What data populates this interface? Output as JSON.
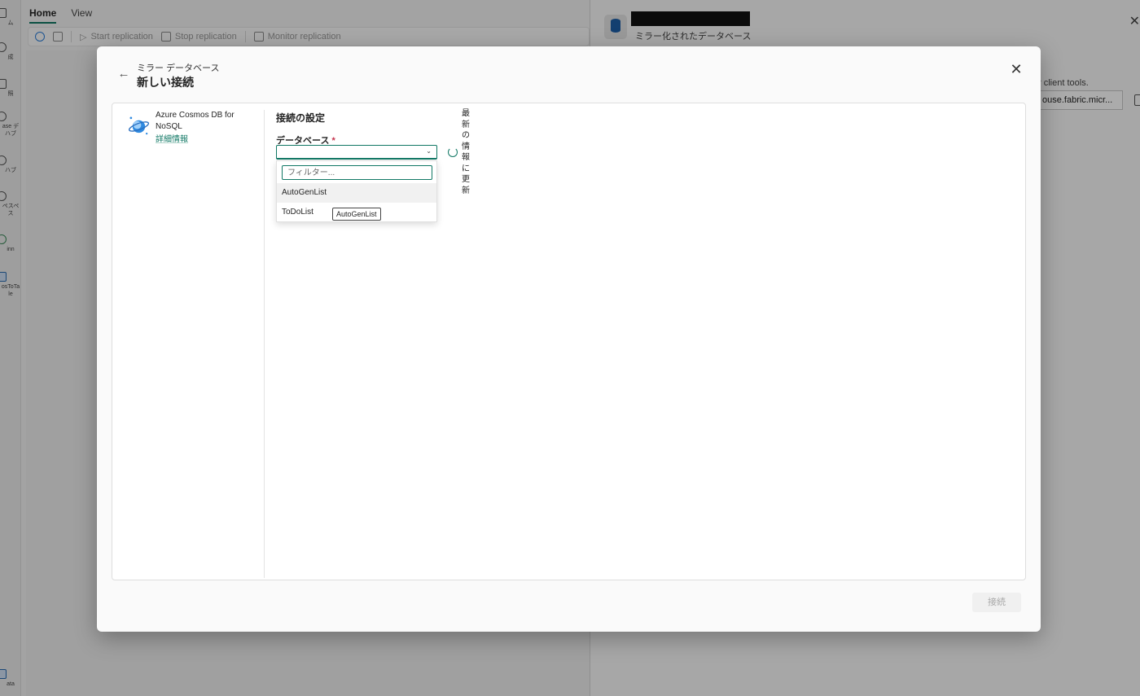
{
  "left_nav": {
    "items": [
      {
        "label": "ム",
        "icon": "home-icon"
      },
      {
        "label": "成",
        "icon": "create-icon"
      },
      {
        "label": "照",
        "icon": "browse-icon"
      },
      {
        "label": "ase デ ハブ",
        "icon": "data-hub-icon"
      },
      {
        "label": "ハブ",
        "icon": "hub-icon"
      },
      {
        "label": "ペスペ ス",
        "icon": "workspace-icon"
      },
      {
        "label": "inn",
        "icon": "item-icon"
      },
      {
        "label": "osToTa le",
        "icon": "mirrored-db-icon"
      },
      {
        "label": "ata",
        "icon": "data-icon"
      }
    ]
  },
  "ribbon": {
    "tabs": [
      "Home",
      "View"
    ],
    "buttons": {
      "start": "Start replication",
      "stop": "Stop replication",
      "monitor": "Monitor replication"
    }
  },
  "right_panel": {
    "subtitle": "ミラー化されたデータベース",
    "hint": "r client tools.",
    "connection_value": "ouse.fabric.micr..."
  },
  "modal": {
    "breadcrumb": "ミラー データベース",
    "title": "新しい接続",
    "source": {
      "name": "Azure Cosmos DB for NoSQL",
      "link": "詳細情報"
    },
    "section_title": "接続の設定",
    "database_label": "データベース",
    "required_mark": "*",
    "refresh_label": "最新の情報に更新",
    "dropdown": {
      "filter_placeholder": "フィルター...",
      "options": [
        "AutoGenList",
        "ToDoList"
      ],
      "tooltip": "AutoGenList"
    },
    "connect_button": "接続"
  },
  "colors": {
    "accent": "#117865",
    "required": "#c4314b"
  }
}
